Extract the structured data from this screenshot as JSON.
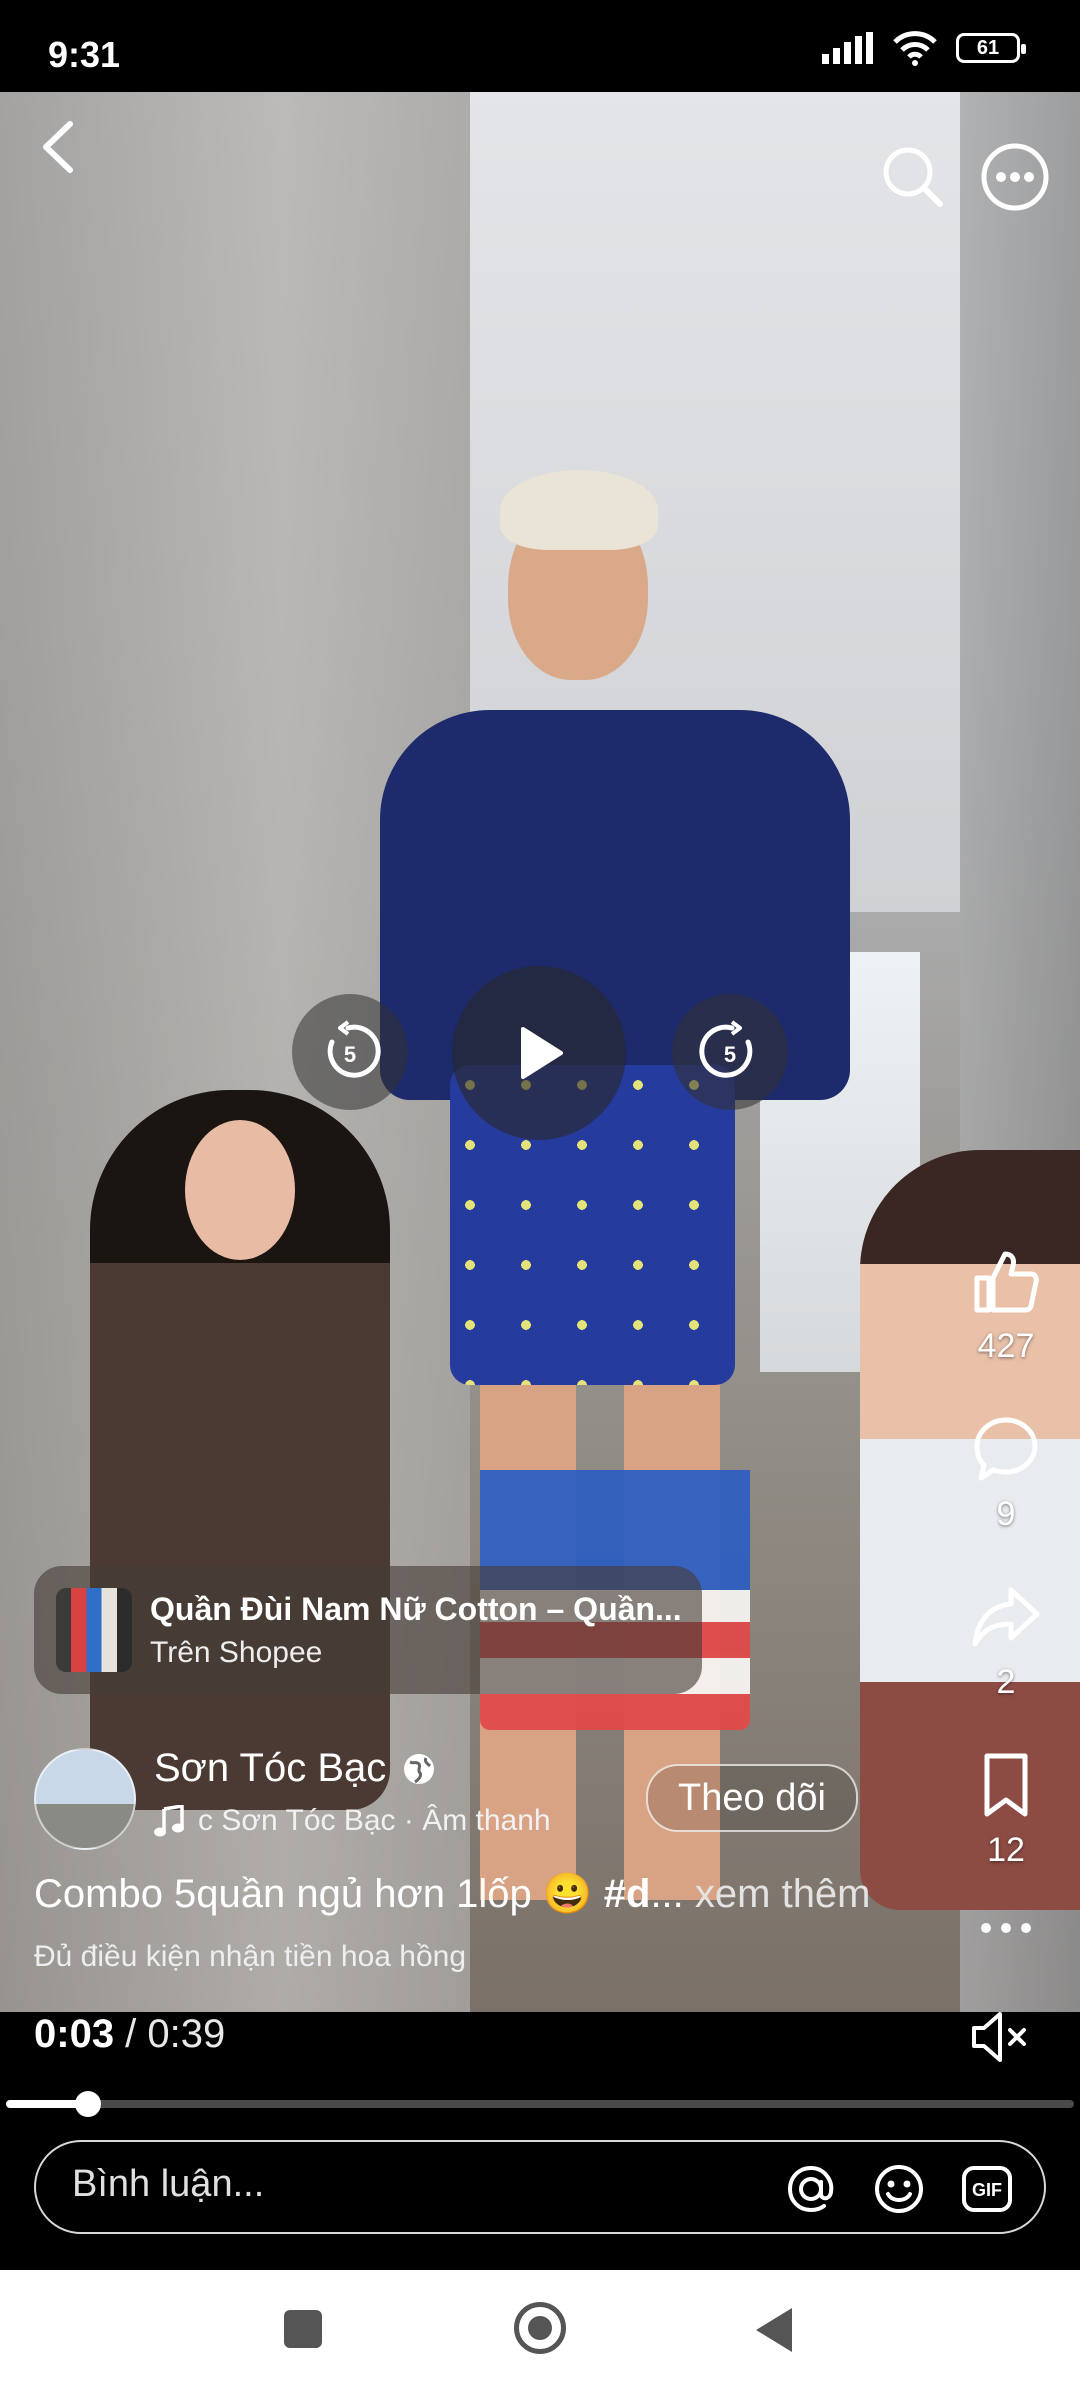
{
  "status_bar": {
    "time": "9:31",
    "battery": "61"
  },
  "actions": {
    "likes": "427",
    "comments": "9",
    "shares": "2",
    "saves": "12"
  },
  "player": {
    "rewind_seconds": "5",
    "forward_seconds": "5",
    "current_time": "0:03",
    "separator": " / ",
    "total_time": "0:39",
    "progress": 0.077
  },
  "product": {
    "title": "Quần Đùi Nam Nữ Cotton – Quần...",
    "source": "Trên Shopee"
  },
  "author": {
    "name": "Sơn Tóc Bạc",
    "music": "c   Sơn Tóc Bạc · Âm thanh",
    "follow_label": "Theo dõi"
  },
  "caption": {
    "text": "Combo 5quần ngủ hơn 1lốp 😀 ",
    "hashtag": "#d",
    "ellipsis": "...",
    "more": " xem thêm"
  },
  "commission_note": "Đủ điều kiện nhận tiền hoa hồng",
  "comment_box": {
    "placeholder": "Bình luận..."
  },
  "icons": [
    "back-icon",
    "search-icon",
    "more-icon",
    "rewind-icon",
    "play-icon",
    "forward-icon",
    "like-icon",
    "comment-icon",
    "share-icon",
    "bookmark-icon",
    "globe-icon",
    "music-icon",
    "mute-icon",
    "mention-icon",
    "emoji-icon",
    "gif-icon"
  ]
}
